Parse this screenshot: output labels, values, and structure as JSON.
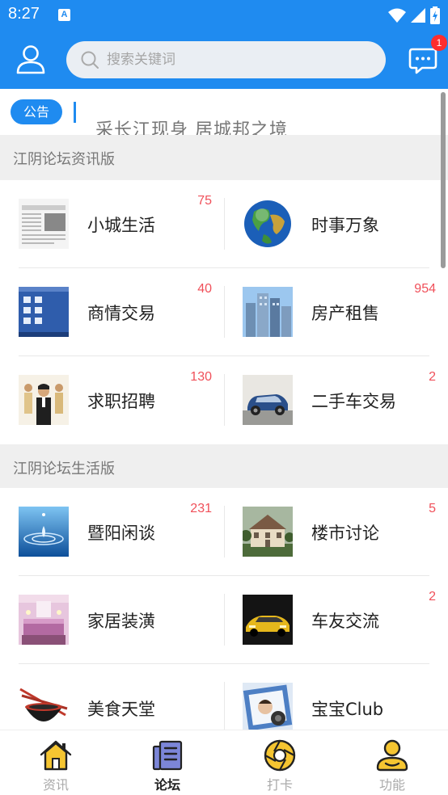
{
  "status": {
    "time": "8:27"
  },
  "search": {
    "placeholder": "搜索关键词"
  },
  "messages": {
    "badge": "1"
  },
  "notice": {
    "tag": "公告",
    "text": "采长江现身 居城邦之境"
  },
  "colors": {
    "primary": "#1f8bf0",
    "count_red": "#f0505a",
    "icon_gold": "#f5c531"
  },
  "sections": [
    {
      "title": "江阴论坛资讯版",
      "items": [
        {
          "label": "小城生活",
          "count": "75",
          "icon": "newspaper-thumb"
        },
        {
          "label": "时事万象",
          "count": "",
          "icon": "globe-thumb"
        },
        {
          "label": "商情交易",
          "count": "40",
          "icon": "desktop-thumb"
        },
        {
          "label": "房产租售",
          "count": "954",
          "icon": "buildings-thumb"
        },
        {
          "label": "求职招聘",
          "count": "130",
          "icon": "people-thumb"
        },
        {
          "label": "二手车交易",
          "count": "2",
          "icon": "car-thumb"
        }
      ]
    },
    {
      "title": "江阴论坛生活版",
      "items": [
        {
          "label": "暨阳闲谈",
          "count": "231",
          "icon": "water-drop-thumb"
        },
        {
          "label": "楼市讨论",
          "count": "5",
          "icon": "house-thumb"
        },
        {
          "label": "家居装潢",
          "count": "",
          "icon": "bedroom-thumb"
        },
        {
          "label": "车友交流",
          "count": "2",
          "icon": "sportscar-thumb"
        },
        {
          "label": "美食天堂",
          "count": "",
          "icon": "bowl-thumb"
        },
        {
          "label": "宝宝Club",
          "count": "",
          "icon": "baby-thumb"
        }
      ]
    }
  ],
  "nav": [
    {
      "label": "资讯",
      "icon": "home-icon",
      "active": false
    },
    {
      "label": "论坛",
      "icon": "forum-icon",
      "active": true
    },
    {
      "label": "打卡",
      "icon": "checkin-icon",
      "active": false
    },
    {
      "label": "功能",
      "icon": "profile-icon",
      "active": false
    }
  ]
}
